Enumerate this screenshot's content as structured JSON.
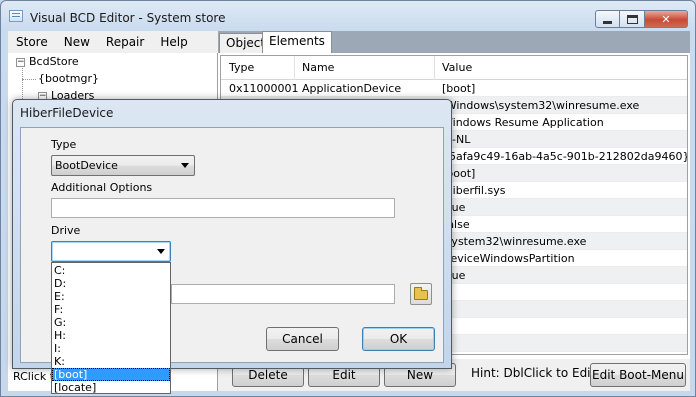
{
  "window": {
    "title": "Visual BCD Editor - System store",
    "min_label": "",
    "max_label": "",
    "close_label": "✕"
  },
  "menu": [
    "Store",
    "New",
    "Repair",
    "Help"
  ],
  "tree": {
    "root": "BcdStore",
    "bootmgr": "{bootmgr}",
    "loaders": "Loaders",
    "expander_minus": "−"
  },
  "tabs": [
    "Object",
    "Elements"
  ],
  "grid": {
    "headers": [
      "Type",
      "Name",
      "Value"
    ],
    "rows": [
      {
        "type": "0x11000001",
        "name": "ApplicationDevice",
        "value": "[boot]"
      },
      {
        "type": "",
        "name": "",
        "value": "\\Windows\\system32\\winresume.exe"
      },
      {
        "type": "",
        "name": "",
        "value": "Windows Resume Application"
      },
      {
        "type": "",
        "name": "",
        "value": "nl-NL"
      },
      {
        "type": "",
        "name": "",
        "value": "{5afa9c49-16ab-4a5c-901b-212802da9460}"
      },
      {
        "type": "",
        "name": "",
        "value": "[boot]"
      },
      {
        "type": "",
        "name": "",
        "value": "\\hiberfil.sys"
      },
      {
        "type": "",
        "name": "",
        "value": "True"
      },
      {
        "type": "",
        "name": "",
        "value": "False"
      },
      {
        "type": "",
        "name": "",
        "value": "\\system32\\winresume.exe"
      },
      {
        "type": "",
        "name": "",
        "value": "DeviceWindowsPartition"
      },
      {
        "type": "",
        "name": "",
        "value": "True"
      }
    ]
  },
  "bottom": {
    "delete": "Delete",
    "edit": "Edit",
    "new": "New",
    "hint": "Hint: DblClick to Edit",
    "edit_boot_menu": "Edit Boot-Menu"
  },
  "status": "RClick to",
  "dialog": {
    "title": "HiberFileDevice",
    "type_label": "Type",
    "type_value": "BootDevice",
    "options_label": "Additional Options",
    "options_value": "",
    "drive_label": "Drive",
    "drive_value": "",
    "path_value": "",
    "cancel": "Cancel",
    "ok": "OK",
    "drive_options": [
      "C:",
      "D:",
      "E:",
      "F:",
      "G:",
      "H:",
      "I:",
      "K:",
      "[boot]",
      "[locate]"
    ],
    "selected_option": "[boot]"
  }
}
